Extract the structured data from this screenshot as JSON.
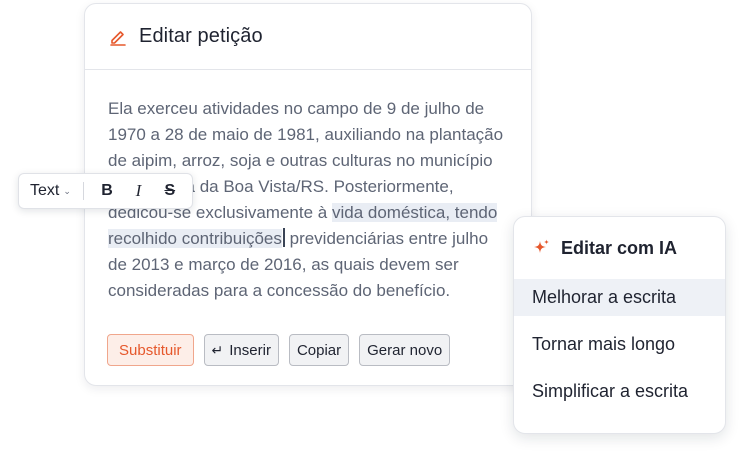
{
  "editor": {
    "title": "Editar petição",
    "text_before": "Ela exerceu atividades no campo de 9 de julho de 1970 a 28 de maio de 1981, auxiliando na plantação de aipim, arroz, soja e outras culturas no município de Santana da Boa Vista/RS. Posteriormente, dedicou-se exclusivamente à ",
    "text_highlight": "vida doméstica, tendo recolhido contribuições",
    "text_after": " previdenciárias entre julho de 2013 e março de 2016, as quais devem ser consideradas para a concessão do benefício.",
    "actions": {
      "replace": "Substituir",
      "insert": "Inserir",
      "copy": "Copiar",
      "regenerate": "Gerar novo"
    }
  },
  "toolbar": {
    "text_style": "Text",
    "bold": "B",
    "italic": "I",
    "strike": "S"
  },
  "ai_menu": {
    "title": "Editar com IA",
    "items": [
      "Melhorar a escrita",
      "Tornar mais longo",
      "Simplificar a escrita"
    ]
  },
  "colors": {
    "accent": "#e6582c",
    "highlight": "#e9edf4",
    "active_item": "#eef1f6"
  },
  "icons": {
    "header": "pencil-icon",
    "ai": "sparkle-icon",
    "insert": "enter-icon",
    "dropdown": "chevron-down-icon"
  }
}
